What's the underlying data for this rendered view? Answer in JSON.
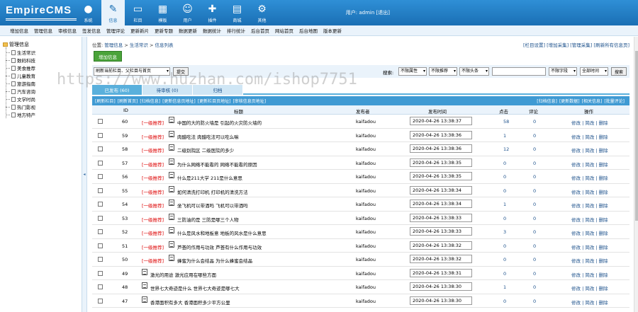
{
  "header": {
    "logo": "EmpireCMS",
    "nav": [
      {
        "label": "系统",
        "icon": "system-icon"
      },
      {
        "label": "信息",
        "icon": "info-icon",
        "active": true
      },
      {
        "label": "栏目",
        "icon": "folder-icon"
      },
      {
        "label": "模板",
        "icon": "template-icon"
      },
      {
        "label": "用户",
        "icon": "user-icon"
      },
      {
        "label": "插件",
        "icon": "plugin-icon"
      },
      {
        "label": "商城",
        "icon": "shop-icon"
      },
      {
        "label": "其他",
        "icon": "gear-icon"
      }
    ],
    "user_prefix": "用户:",
    "user_name": "admin",
    "logout": "[退出]"
  },
  "submenu": [
    "增加信息",
    "管理信息",
    "审核信息",
    "签发信息",
    "管理评论",
    "更新新片",
    "更新专题",
    "数据更新",
    "数据统计",
    "排行统计",
    "后台首页",
    "网站首页",
    "后台地图",
    "版本更新"
  ],
  "tree": {
    "root": "管理信息",
    "items": [
      "生活常识",
      "数码科技",
      "美食推荐",
      "儿童教育",
      "旅游指南",
      "汽车咨询",
      "文学时尚",
      "热门影视",
      "地方特产"
    ]
  },
  "main": {
    "crumb_prefix": "位置:",
    "crumb": [
      "管理信息",
      "生活常识",
      "信息列表"
    ],
    "toplinks": "[栏目设置] [增加采集] [管理采集] [刷新所有信息页]",
    "add_button": "增加信息",
    "filter": {
      "column_select": "刷新当前栏目、父栏目与首页",
      "submit": "提交",
      "search_label": "搜索:",
      "attr_select": "不限属性",
      "rec_select": "不限推荐",
      "head_select": "不限头条",
      "field_select": "不限字段",
      "time_select": "全部时间",
      "search_button": "搜索"
    },
    "tabs": [
      {
        "label": "已发布 (60)",
        "active": true
      },
      {
        "label": "待审核 (0)"
      },
      {
        "label": "归档"
      }
    ],
    "actions_left": [
      "[刷新栏目]",
      "[刷新首页]",
      "[归档信息]",
      "[更新信息页地址]",
      "[更新栏目页地址]",
      "[审核信息页地址]"
    ],
    "actions_right": [
      "[归档信息]",
      "[更新数据]",
      "[相关信息]",
      "[批量评论]"
    ],
    "columns": [
      "ID",
      "标题",
      "发布者",
      "发布时间",
      "点击",
      "评论",
      "操作"
    ],
    "rows": [
      {
        "id": "60",
        "badge": "[一级推荐]",
        "title": "中国的大的防火墙是 引起的火灾防火墙的",
        "author": "kaifadou",
        "time": "2020-04-26 13:38:37",
        "clicks": "58",
        "comments": "0",
        "ops": "修改 | 简改 | 删除"
      },
      {
        "id": "59",
        "badge": "[一级推荐]",
        "title": "肉醋吃法 肉醋吃法可以吃么嘛",
        "author": "kaifadou",
        "time": "2020-04-26 13:38:36",
        "clicks": "1",
        "comments": "0",
        "ops": "修改 | 简改 | 删除"
      },
      {
        "id": "58",
        "badge": "[一级推荐]",
        "title": "二级别院区 二级医院的多少",
        "author": "kaifadou",
        "time": "2020-04-26 13:38:36",
        "clicks": "12",
        "comments": "0",
        "ops": "修改 | 简改 | 删除"
      },
      {
        "id": "57",
        "badge": "[一级推荐]",
        "title": "为什么网络不能看的 网络不能看的原因",
        "author": "kaifadou",
        "time": "2020-04-26 13:38:35",
        "clicks": "0",
        "comments": "0",
        "ops": "修改 | 简改 | 删除"
      },
      {
        "id": "56",
        "badge": "[一级推荐]",
        "title": "什么是211大学 211是什么意思",
        "author": "kaifadou",
        "time": "2020-04-26 13:38:35",
        "clicks": "0",
        "comments": "0",
        "ops": "修改 | 简改 | 删除"
      },
      {
        "id": "55",
        "badge": "[一级推荐]",
        "title": "如何清洗打印机 打印机的清洗方法",
        "author": "kaifadou",
        "time": "2020-04-26 13:38:34",
        "clicks": "0",
        "comments": "0",
        "ops": "修改 | 简改 | 删除"
      },
      {
        "id": "54",
        "badge": "[一级推荐]",
        "title": "坐飞机可以带酒吗 飞机可以带酒吗",
        "author": "kaifadou",
        "time": "2020-04-26 13:38:34",
        "clicks": "1",
        "comments": "0",
        "ops": "修改 | 简改 | 删除"
      },
      {
        "id": "53",
        "badge": "[一级推荐]",
        "title": "三防油的是 三防是哪三个人物",
        "author": "kaifadou",
        "time": "2020-04-26 13:38:33",
        "clicks": "0",
        "comments": "0",
        "ops": "修改 | 简改 | 删除"
      },
      {
        "id": "52",
        "badge": "[一级推荐]",
        "title": "什么是风水和地板意 地板的风水是什么意思",
        "author": "kaifadou",
        "time": "2020-04-26 13:38:33",
        "clicks": "3",
        "comments": "0",
        "ops": "修改 | 简改 | 删除"
      },
      {
        "id": "51",
        "badge": "[一级推荐]",
        "title": "芦荟的作用与功效 芦荟有什么作用与功效",
        "author": "kaifadou",
        "time": "2020-04-26 13:38:32",
        "clicks": "0",
        "comments": "0",
        "ops": "修改 | 简改 | 删除"
      },
      {
        "id": "50",
        "badge": "[一级推荐]",
        "title": "蜂蜜为什么会结晶 为什么蜂蜜会结晶",
        "author": "kaifadou",
        "time": "2020-04-26 13:38:32",
        "clicks": "0",
        "comments": "0",
        "ops": "修改 | 简改 | 删除"
      },
      {
        "id": "49",
        "badge": "",
        "title": "激光的用途 激光应用在哪些方面",
        "author": "kaifadou",
        "time": "2020-04-26 13:38:31",
        "clicks": "0",
        "comments": "0",
        "ops": "修改 | 简改 | 删除"
      },
      {
        "id": "48",
        "badge": "",
        "title": "世界七大奇迹是什么 世界七大奇迹是哪七大",
        "author": "kaifadou",
        "time": "2020-04-26 13:38:30",
        "clicks": "1",
        "comments": "0",
        "ops": "修改 | 简改 | 删除"
      },
      {
        "id": "47",
        "badge": "",
        "title": "香港面积有多大 香港面积多少平方公里",
        "author": "kaifadou",
        "time": "2020-04-26 13:38:30",
        "clicks": "0",
        "comments": "0",
        "ops": "修改 | 简改 | 删除"
      }
    ]
  },
  "watermark": "https://www.huzhan.com/ishop7751"
}
